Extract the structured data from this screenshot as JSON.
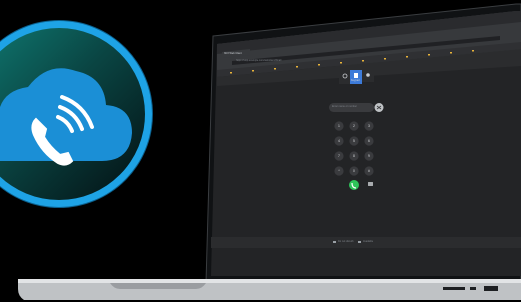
{
  "badge": {
    "cloud_icon": "cloud-icon",
    "phone_icon": "phone-call-icon",
    "colors": {
      "ring": "#1ea3e6",
      "cloud": "#1b8fd6",
      "inner": "#0a4543"
    }
  },
  "browser": {
    "tab_title": "3CX Web Client",
    "address": "https://voip.example.com/webclient/#/call",
    "bookmarks": [
      "Apps",
      "Gmail",
      "YouTube",
      "Maps",
      "News",
      "Drive",
      "Calendar",
      "Docs",
      "Sheets",
      "Photos",
      "Translate",
      "Meet",
      "Contacts",
      "Keep"
    ]
  },
  "app": {
    "tabs": [
      {
        "icon": "history-icon",
        "label": "History"
      },
      {
        "icon": "keypad-icon",
        "label": "Keypad"
      },
      {
        "icon": "contacts-icon",
        "label": "Contacts"
      }
    ],
    "number_placeholder": "Enter name or number",
    "keys": [
      {
        "digit": "1",
        "letters": ""
      },
      {
        "digit": "2",
        "letters": "ABC"
      },
      {
        "digit": "3",
        "letters": "DEF"
      },
      {
        "digit": "4",
        "letters": "GHI"
      },
      {
        "digit": "5",
        "letters": "JKL"
      },
      {
        "digit": "6",
        "letters": "MNO"
      },
      {
        "digit": "7",
        "letters": "PQRS"
      },
      {
        "digit": "8",
        "letters": "TUV"
      },
      {
        "digit": "9",
        "letters": "WXYZ"
      },
      {
        "digit": "*",
        "letters": ""
      },
      {
        "digit": "0",
        "letters": "+"
      },
      {
        "digit": "#",
        "letters": ""
      }
    ],
    "footer": [
      "Do not disturb",
      "Available"
    ],
    "colors": {
      "call": "#2ec45a",
      "accent": "#3d7bd9",
      "panel": "#2b2c2e"
    }
  }
}
